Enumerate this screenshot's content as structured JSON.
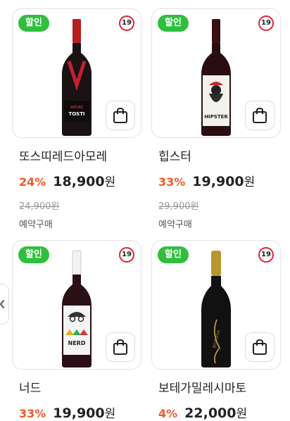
{
  "products": [
    {
      "badge": "할인",
      "age": "19",
      "name": "또스띠레드아모레",
      "discount": "24%",
      "price": "18,900",
      "won": "원",
      "original": "24,900원",
      "preorder": "예약구매",
      "label_top": "AMORE",
      "label_main": "TOSTI"
    },
    {
      "badge": "할인",
      "age": "19",
      "name": "힙스터",
      "discount": "33%",
      "price": "19,900",
      "won": "원",
      "original": "29,900원",
      "preorder": "예약구매",
      "label_main": "HIPSTER"
    },
    {
      "badge": "할인",
      "age": "19",
      "name": "너드",
      "discount": "33%",
      "price": "19,900",
      "won": "원",
      "label_main": "NERD"
    },
    {
      "badge": "할인",
      "age": "19",
      "name": "보테가밀레시마토",
      "discount": "4%",
      "price": "22,000",
      "won": "원",
      "label_main": "BOTTEGA"
    }
  ]
}
